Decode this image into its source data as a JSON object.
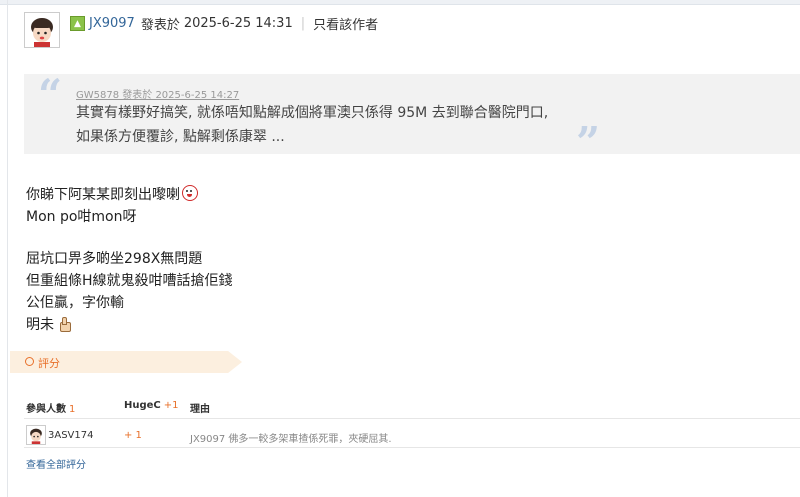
{
  "header": {
    "author": "JX9097",
    "posted_label": "發表於",
    "date": "2025-6-25 14:31",
    "separator": "|",
    "only_author_label": "只看該作者"
  },
  "quote": {
    "meta": "GW5878 發表於 2025-6-25 14:27",
    "lines": [
      "其實有樣野好搞笑, 就係唔知點解成個將軍澳只係得 95M 去到聯合醫院門口,",
      "如果係方便覆診, 點解剩係康翠 ..."
    ]
  },
  "message": {
    "lines": [
      "你睇下阿某某即刻出嚟喇",
      "Mon po咁mon呀",
      "屈坑口畀多啲坐298X無問題",
      "但重組條H線就鬼殺咁嘈話搶佢錢",
      "公佢贏，字你輸",
      "明未"
    ],
    "emojis": [
      "clown-face",
      "thumbs-up"
    ]
  },
  "rating": {
    "tab_label": "評分",
    "columns": {
      "participants_label": "參與人數",
      "participants_count": "1",
      "currency_label": "HugeC",
      "currency_total": "+1",
      "reason_label": "理由"
    },
    "rows": [
      {
        "user": "3ASV174",
        "score": "+ 1",
        "reason": "JX9097 佛多一較多架車揸係死罪，夾硬屈其."
      }
    ],
    "view_all": "查看全部評分"
  },
  "colors": {
    "link": "#336699",
    "accent": "#e8702a",
    "quote_bg": "#f2f2f2",
    "quote_mark": "#c5d3e6",
    "rate_tab_bg": "#fcefdf"
  }
}
